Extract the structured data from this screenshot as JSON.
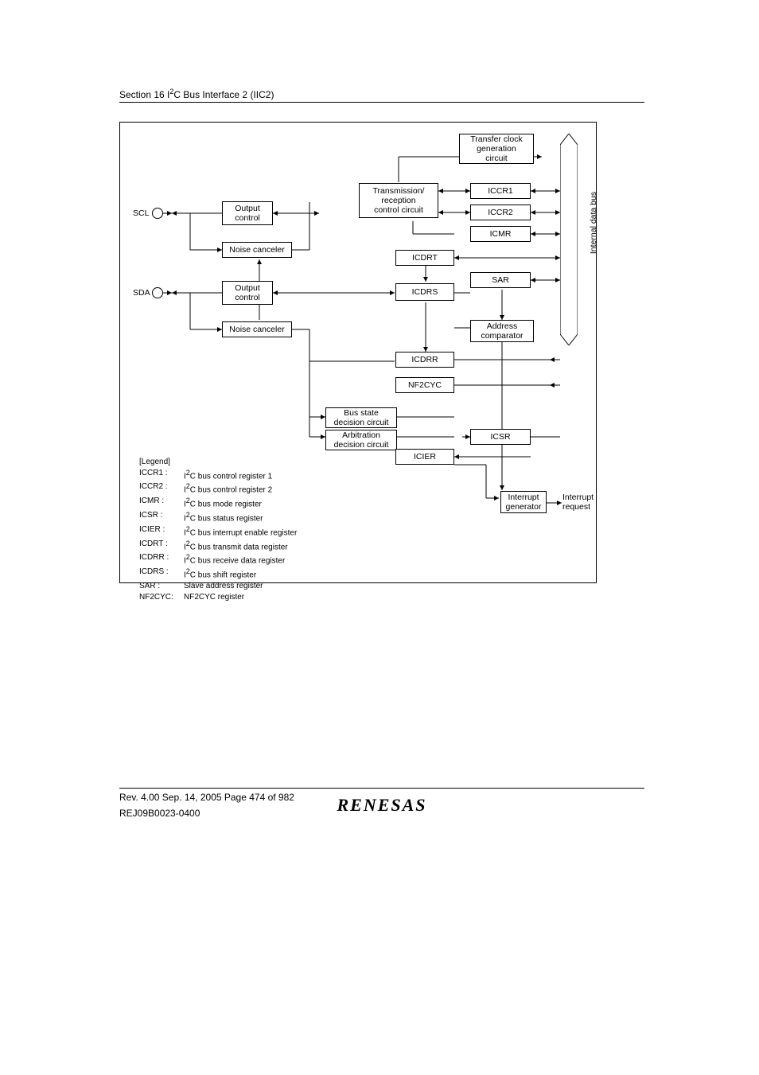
{
  "header": {
    "section_prefix": "Section 16   I",
    "section_sup": "2",
    "section_suffix": "C Bus Interface 2 (IIC2)"
  },
  "pins": {
    "scl": "SCL",
    "sda": "SDA"
  },
  "blocks": {
    "out_ctrl_1": "Output\ncontrol",
    "out_ctrl_2": "Output\ncontrol",
    "noise_1": "Noise canceler",
    "noise_2": "Noise canceler",
    "xfer_clock": "Transfer clock\ngeneration\ncircuit",
    "tx_rx_ctrl": "Transmission/\nreception\ncontrol circuit",
    "iccr1": "ICCR1",
    "iccr2": "ICCR2",
    "icmr": "ICMR",
    "icdrt": "ICDRT",
    "sar": "SAR",
    "icdrs": "ICDRS",
    "addr_cmp": "Address\ncomparator",
    "icdrr": "ICDRR",
    "nf2cyc": "NF2CYC",
    "bus_state": "Bus state\ndecision circuit",
    "arb": "Arbitration\ndecision circuit",
    "icsr": "ICSR",
    "icier": "ICIER",
    "int_gen": "Interrupt\ngenerator"
  },
  "bus_label": "Internal data bus",
  "interrupt_out": "Interrupt\nrequest",
  "legend_title": "[Legend]",
  "legend": [
    {
      "k": "ICCR1 :",
      "v_pre": "I",
      "v_sup": "2",
      "v_post": "C bus control register 1"
    },
    {
      "k": "ICCR2 :",
      "v_pre": "I",
      "v_sup": "2",
      "v_post": "C bus control register 2"
    },
    {
      "k": "ICMR :",
      "v_pre": "I",
      "v_sup": "2",
      "v_post": "C bus mode register"
    },
    {
      "k": "ICSR :",
      "v_pre": "I",
      "v_sup": "2",
      "v_post": "C bus status register"
    },
    {
      "k": "ICIER :",
      "v_pre": "I",
      "v_sup": "2",
      "v_post": "C bus interrupt enable register"
    },
    {
      "k": "ICDRT :",
      "v_pre": "I",
      "v_sup": "2",
      "v_post": "C bus transmit data register"
    },
    {
      "k": "ICDRR :",
      "v_pre": "I",
      "v_sup": "2",
      "v_post": "C bus receive data register"
    },
    {
      "k": "ICDRS :",
      "v_pre": "I",
      "v_sup": "2",
      "v_post": "C bus shift register"
    },
    {
      "k": "SAR :",
      "v_pre": "",
      "v_sup": "",
      "v_post": "Slave address register"
    },
    {
      "k": "NF2CYC:",
      "v_pre": "",
      "v_sup": "",
      "v_post": "NF2CYC register"
    }
  ],
  "footer": {
    "line1": "Rev. 4.00  Sep. 14, 2005  Page 474 of 982",
    "line2": "REJ09B0023-0400",
    "brand": "RENESAS"
  }
}
